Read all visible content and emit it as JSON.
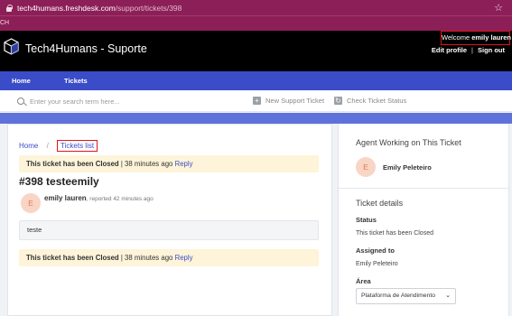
{
  "browser": {
    "url_host": "tech4humans.freshdesk.com",
    "url_path": "/support/tickets/398",
    "bookmark_text": "CH"
  },
  "header": {
    "brand": "Tech4Humans - Suporte",
    "welcome_prefix": "Welcome",
    "welcome_user": "emily lauren",
    "edit_profile": "Edit profile",
    "separator": "|",
    "sign_out": "Sign out"
  },
  "nav": {
    "tabs": [
      {
        "label": "Home"
      },
      {
        "label": "Tickets"
      }
    ]
  },
  "search": {
    "placeholder": "Enter your search term here...",
    "new_ticket": "New Support Ticket",
    "check_status": "Check Ticket Status"
  },
  "breadcrumb": {
    "home": "Home",
    "separator": "/",
    "current": "Tickets list"
  },
  "ticket": {
    "banner_status": "This ticket has been Closed",
    "banner_time": " | 38 minutes ago",
    "banner_reply": "Reply",
    "title": "#398 testeemily",
    "author_initial": "E",
    "author": "emily lauren",
    "reported": ", reported 42 minutes ago",
    "message": "teste"
  },
  "sidebar": {
    "agent_heading": "Agent Working on This Ticket",
    "agent_initial": "E",
    "agent_name": "Emily Peleteiro",
    "details_heading": "Ticket details",
    "status_label": "Status",
    "status_value": "This ticket has been Closed",
    "assigned_label": "Assigned to",
    "assigned_value": "Emily Peleteiro",
    "area_label": "Área",
    "area_value": "Plataforma de Atendimento"
  },
  "colors": {
    "chrome": "#8c1f57",
    "nav": "#3a4cc7",
    "highlight_box": "#e0141d",
    "banner": "#fdf4d9"
  }
}
